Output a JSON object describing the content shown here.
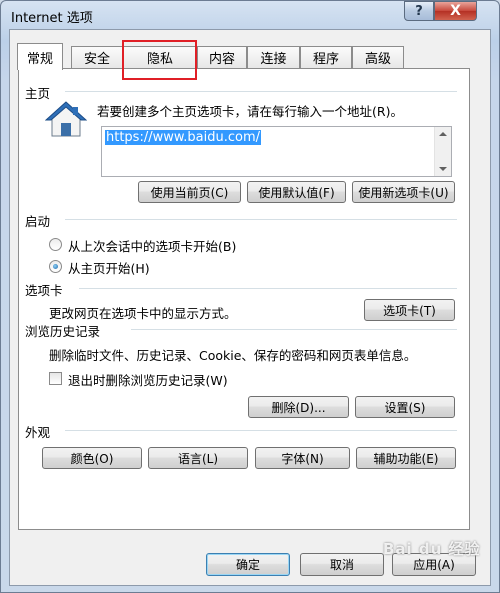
{
  "window": {
    "title": "Internet 选项",
    "help_glyph": "?",
    "close_glyph": "X"
  },
  "tabs": [
    {
      "label": "常规",
      "active": true
    },
    {
      "label": "安全"
    },
    {
      "label": "隐私"
    },
    {
      "label": "内容"
    },
    {
      "label": "连接"
    },
    {
      "label": "程序"
    },
    {
      "label": "高级"
    }
  ],
  "homepage": {
    "heading": "主页",
    "instruction": "若要创建多个主页选项卡，请在每行输入一个地址(R)。",
    "url": "https://www.baidu.com/",
    "buttons": [
      "使用当前页(C)",
      "使用默认值(F)",
      "使用新选项卡(U)"
    ]
  },
  "startup": {
    "heading": "启动",
    "options": [
      {
        "label": "从上次会话中的选项卡开始(B)",
        "checked": false
      },
      {
        "label": "从主页开始(H)",
        "checked": true
      }
    ]
  },
  "tabs_group": {
    "heading": "选项卡",
    "description": "更改网页在选项卡中的显示方式。",
    "button": "选项卡(T)"
  },
  "history": {
    "heading": "浏览历史记录",
    "description": "删除临时文件、历史记录、Cookie、保存的密码和网页表单信息。",
    "checkbox_label": "退出时删除浏览历史记录(W)",
    "checkbox_checked": false,
    "delete_button": "删除(D)...",
    "settings_button": "设置(S)"
  },
  "appearance": {
    "heading": "外观",
    "buttons": [
      "颜色(O)",
      "语言(L)",
      "字体(N)",
      "辅助功能(E)"
    ]
  },
  "footer": {
    "ok": "确定",
    "cancel": "取消",
    "apply": "应用(A)"
  },
  "watermark": "Bai du 经验",
  "colors": {
    "highlight_box": "#e01f26",
    "selection": "#3399ff",
    "icon_house_roof": "#2e6fb8"
  }
}
